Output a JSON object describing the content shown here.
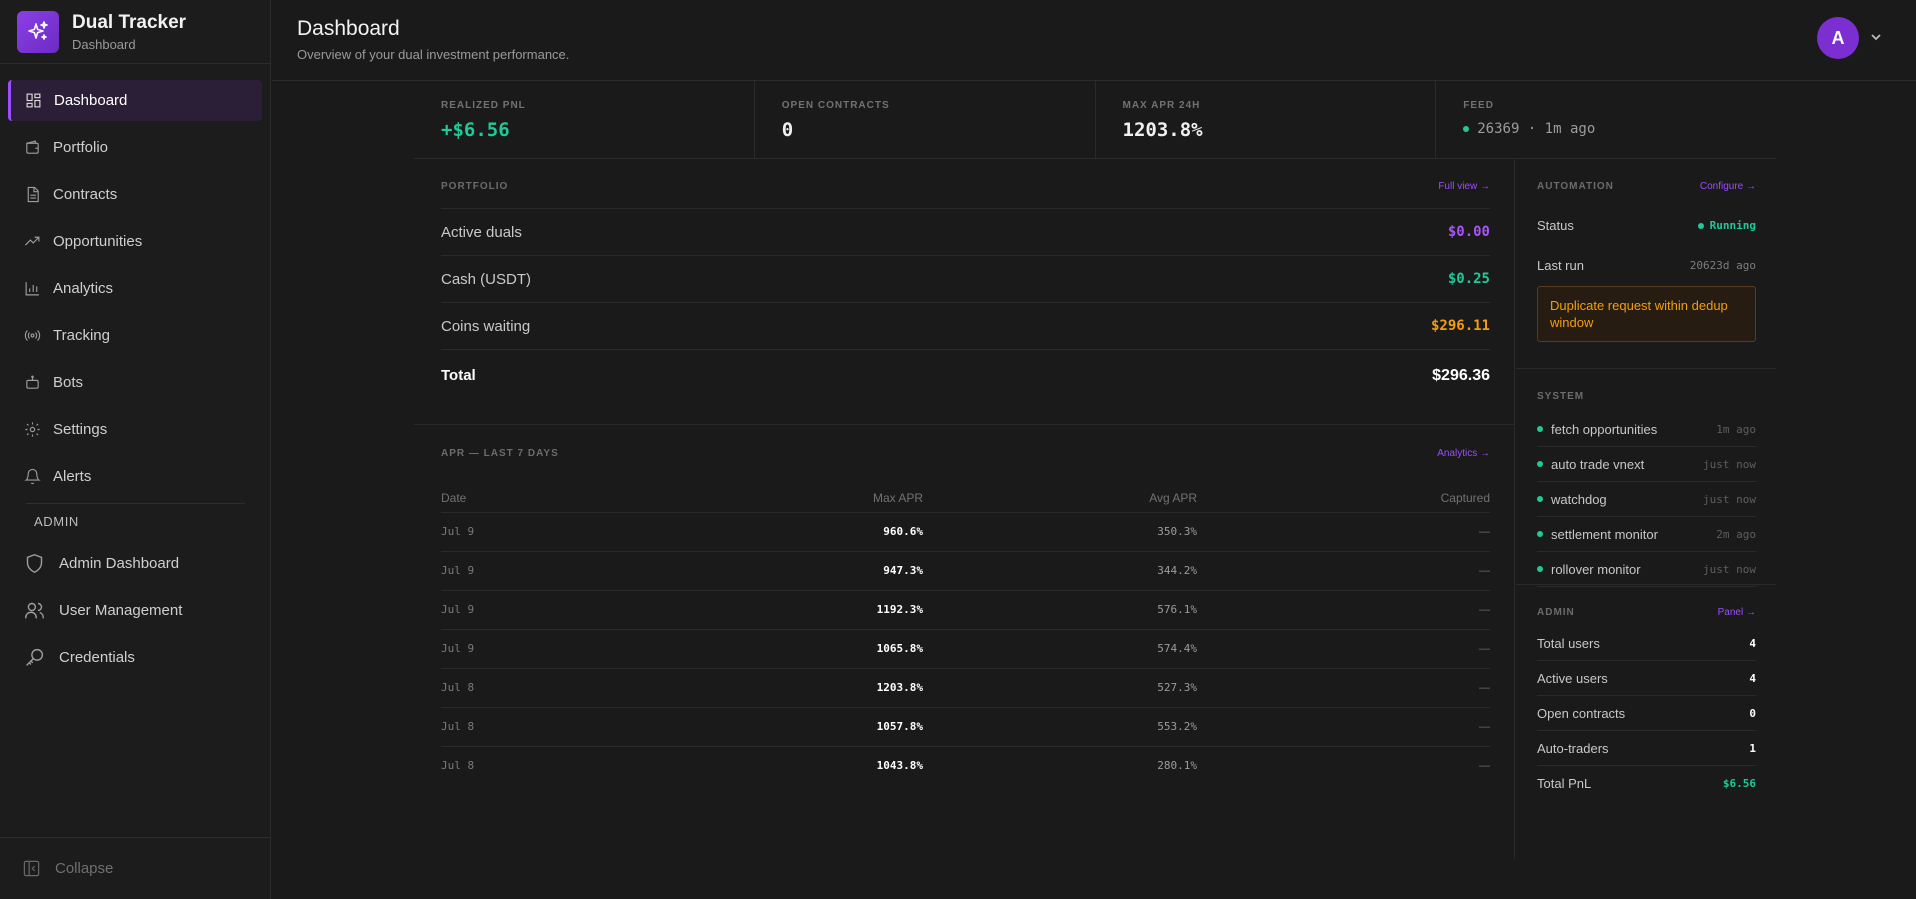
{
  "brand": {
    "title": "Dual Tracker",
    "subtitle": "Dashboard"
  },
  "nav": {
    "items": [
      {
        "label": "Dashboard",
        "icon": "dashboard-icon",
        "active": true
      },
      {
        "label": "Portfolio",
        "icon": "wallet-icon"
      },
      {
        "label": "Contracts",
        "icon": "document-icon"
      },
      {
        "label": "Opportunities",
        "icon": "trending-up-icon"
      },
      {
        "label": "Analytics",
        "icon": "bar-chart-icon"
      },
      {
        "label": "Tracking",
        "icon": "radio-icon"
      },
      {
        "label": "Bots",
        "icon": "bot-icon"
      },
      {
        "label": "Settings",
        "icon": "gear-icon"
      },
      {
        "label": "Alerts",
        "icon": "bell-icon"
      }
    ],
    "admin_label": "ADMIN",
    "admin_items": [
      {
        "label": "Admin Dashboard",
        "icon": "shield-icon"
      },
      {
        "label": "User Management",
        "icon": "users-icon"
      },
      {
        "label": "Credentials",
        "icon": "key-icon"
      }
    ],
    "collapse_label": "Collapse"
  },
  "header": {
    "title": "Dashboard",
    "subtitle": "Overview of your dual investment performance.",
    "avatar_letter": "A"
  },
  "stats": {
    "realized_pnl": {
      "label": "REALIZED PNL",
      "value": "+$6.56"
    },
    "open_contracts": {
      "label": "OPEN CONTRACTS",
      "value": "0"
    },
    "max_apr": {
      "label": "MAX APR 24H",
      "value": "1203.8%"
    },
    "feed": {
      "label": "FEED",
      "value": "26369 · 1m ago"
    }
  },
  "portfolio": {
    "title": "PORTFOLIO",
    "link": "Full view →",
    "rows": [
      {
        "label": "Active duals",
        "value": "$0.00"
      },
      {
        "label": "Cash (USDT)",
        "value": "$0.25"
      },
      {
        "label": "Coins waiting",
        "value": "$296.11"
      }
    ],
    "total_label": "Total",
    "total_value": "$296.36"
  },
  "apr": {
    "title": "APR — LAST 7 DAYS",
    "link": "Analytics →",
    "columns": [
      "Date",
      "Max APR",
      "Avg APR",
      "Captured"
    ],
    "rows": [
      [
        "Jul 9",
        "960.6%",
        "350.3%",
        "—"
      ],
      [
        "Jul 9",
        "947.3%",
        "344.2%",
        "—"
      ],
      [
        "Jul 9",
        "1192.3%",
        "576.1%",
        "—"
      ],
      [
        "Jul 9",
        "1065.8%",
        "574.4%",
        "—"
      ],
      [
        "Jul 8",
        "1203.8%",
        "527.3%",
        "—"
      ],
      [
        "Jul 8",
        "1057.8%",
        "553.2%",
        "—"
      ],
      [
        "Jul 8",
        "1043.8%",
        "280.1%",
        "—"
      ]
    ]
  },
  "automation": {
    "title": "AUTOMATION",
    "link": "Configure →",
    "status_label": "Status",
    "status_value": "Running",
    "lastrun_label": "Last run",
    "lastrun_value": "20623d ago",
    "alert": "Duplicate request within dedup window"
  },
  "system": {
    "title": "SYSTEM",
    "rows": [
      {
        "name": "fetch opportunities",
        "time": "1m ago"
      },
      {
        "name": "auto trade vnext",
        "time": "just now"
      },
      {
        "name": "watchdog",
        "time": "just now"
      },
      {
        "name": "settlement monitor",
        "time": "2m ago"
      },
      {
        "name": "rollover monitor",
        "time": "just now"
      }
    ]
  },
  "admin": {
    "title": "ADMIN",
    "link": "Panel →",
    "rows": [
      {
        "label": "Total users",
        "value": "4"
      },
      {
        "label": "Active users",
        "value": "4"
      },
      {
        "label": "Open contracts",
        "value": "0"
      },
      {
        "label": "Auto-traders",
        "value": "1"
      },
      {
        "label": "Total PnL",
        "value": "$6.56"
      }
    ]
  },
  "colors": {
    "accent": "#9b4dff",
    "positive": "#20c997",
    "warning": "#f59e0b",
    "background": "#1a1a1a"
  }
}
